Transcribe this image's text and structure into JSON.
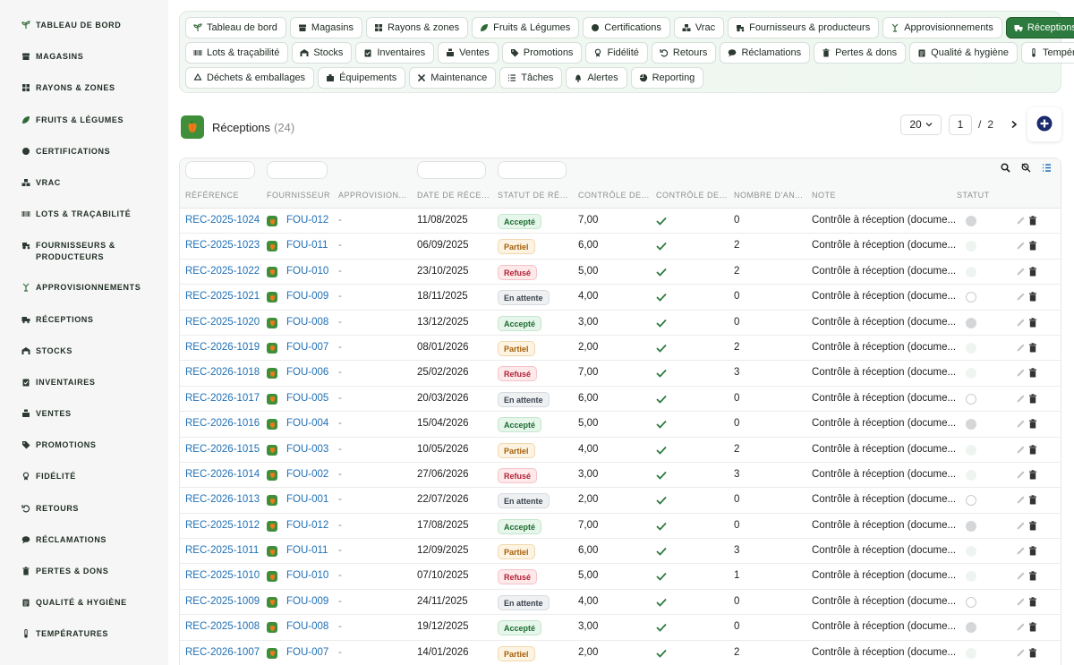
{
  "sidebar": {
    "items": [
      {
        "label": "TABLEAU DE BORD",
        "icon": "sprout-icon"
      },
      {
        "label": "MAGASINS",
        "icon": "store-icon"
      },
      {
        "label": "RAYONS & ZONES",
        "icon": "grid-icon"
      },
      {
        "label": "FRUITS & LÉGUMES",
        "icon": "leaf-icon"
      },
      {
        "label": "CERTIFICATIONS",
        "icon": "badge-icon"
      },
      {
        "label": "VRAC",
        "icon": "boxes-icon"
      },
      {
        "label": "LOTS & TRAÇABILITÉ",
        "icon": "barcode-icon"
      },
      {
        "label": "FOURNISSEURS &",
        "label2": "PRODUCTEURS",
        "icon": "tractor-icon"
      },
      {
        "label": "APPROVISIONNEMENTS",
        "icon": "seedling-icon"
      },
      {
        "label": "RÉCEPTIONS",
        "icon": "truck-icon"
      },
      {
        "label": "STOCKS",
        "icon": "warehouse-icon"
      },
      {
        "label": "INVENTAIRES",
        "icon": "clipboard-icon"
      },
      {
        "label": "VENTES",
        "icon": "cash-register-icon"
      },
      {
        "label": "PROMOTIONS",
        "icon": "tag-icon"
      },
      {
        "label": "FIDÉLITÉ",
        "icon": "award-icon"
      },
      {
        "label": "RETOURS",
        "icon": "undo-icon"
      },
      {
        "label": "RÉCLAMATIONS",
        "icon": "comment-icon"
      },
      {
        "label": "PERTES & DONS",
        "icon": "trash-icon"
      },
      {
        "label": "QUALITÉ & HYGIÈNE",
        "icon": "clipboard-check-icon"
      },
      {
        "label": "TEMPÉRATURES",
        "icon": "thermometer-icon"
      }
    ]
  },
  "tabs": [
    [
      {
        "label": "Tableau de bord",
        "icon": "sprout-icon"
      },
      {
        "label": "Magasins",
        "icon": "store-icon"
      },
      {
        "label": "Rayons & zones",
        "icon": "grid-icon"
      },
      {
        "label": "Fruits & Légumes",
        "icon": "leaf-icon"
      },
      {
        "label": "Certifications",
        "icon": "badge-icon"
      },
      {
        "label": "Vrac",
        "icon": "boxes-icon"
      },
      {
        "label": "Fournisseurs & producteurs",
        "icon": "tractor-icon"
      },
      {
        "label": "Approvisionnements",
        "icon": "seedling-icon"
      },
      {
        "label": "Réceptions",
        "icon": "truck-icon",
        "active": true
      }
    ],
    [
      {
        "label": "Lots & traçabilité",
        "icon": "barcode-icon"
      },
      {
        "label": "Stocks",
        "icon": "warehouse-icon"
      },
      {
        "label": "Inventaires",
        "icon": "clipboard-icon"
      },
      {
        "label": "Ventes",
        "icon": "cash-register-icon"
      },
      {
        "label": "Promotions",
        "icon": "tag-icon"
      },
      {
        "label": "Fidélité",
        "icon": "award-icon"
      },
      {
        "label": "Retours",
        "icon": "undo-icon"
      },
      {
        "label": "Réclamations",
        "icon": "comment-icon"
      },
      {
        "label": "Pertes & dons",
        "icon": "trash-icon"
      },
      {
        "label": "Qualité & hygiène",
        "icon": "clipboard-check-icon"
      },
      {
        "label": "Températures",
        "icon": "thermometer-icon"
      }
    ],
    [
      {
        "label": "Déchets & emballages",
        "icon": "recycle-icon"
      },
      {
        "label": "Équipements",
        "icon": "equipment-icon"
      },
      {
        "label": "Maintenance",
        "icon": "tools-icon"
      },
      {
        "label": "Tâches",
        "icon": "list-icon"
      },
      {
        "label": "Alertes",
        "icon": "bell-icon"
      },
      {
        "label": "Reporting",
        "icon": "chart-pie-icon"
      }
    ]
  ],
  "page": {
    "title": "Réceptions",
    "count": "(24)"
  },
  "pager": {
    "page_size": "20",
    "current_page": "1",
    "separator": "/",
    "total_pages": "2"
  },
  "table": {
    "columns": [
      "RÉFÉRENCE",
      "FOURNISSEUR",
      "APPROVISION...",
      "DATE DE RÉCEP...",
      "STATUT DE RÉC...",
      "CONTRÔLE DE ...",
      "CONTRÔLE DE ...",
      "NOMBRE D'AN...",
      "NOTE",
      "STATUT"
    ],
    "rows": [
      {
        "ref": "REC-2025-1024",
        "supplier": "FOU-012",
        "appro": "-",
        "date": "11/08/2025",
        "status": "Accepté",
        "kind": "accepte",
        "ctrl": "7,00",
        "count": "0",
        "note": "Contrôle à réception (docume...",
        "dot": "grey"
      },
      {
        "ref": "REC-2025-1023",
        "supplier": "FOU-011",
        "appro": "-",
        "date": "06/09/2025",
        "status": "Partiel",
        "kind": "partiel",
        "ctrl": "6,00",
        "count": "2",
        "note": "Contrôle à réception (docume...",
        "dot": "pale"
      },
      {
        "ref": "REC-2025-1022",
        "supplier": "FOU-010",
        "appro": "-",
        "date": "23/10/2025",
        "status": "Refusé",
        "kind": "refuse",
        "ctrl": "5,00",
        "count": "2",
        "note": "Contrôle à réception (docume...",
        "dot": "pale"
      },
      {
        "ref": "REC-2025-1021",
        "supplier": "FOU-009",
        "appro": "-",
        "date": "18/11/2025",
        "status": "En attente",
        "kind": "attente",
        "ctrl": "4,00",
        "count": "0",
        "note": "Contrôle à réception (docume...",
        "dot": "ring"
      },
      {
        "ref": "REC-2025-1020",
        "supplier": "FOU-008",
        "appro": "-",
        "date": "13/12/2025",
        "status": "Accepté",
        "kind": "accepte",
        "ctrl": "3,00",
        "count": "0",
        "note": "Contrôle à réception (docume...",
        "dot": "grey"
      },
      {
        "ref": "REC-2026-1019",
        "supplier": "FOU-007",
        "appro": "-",
        "date": "08/01/2026",
        "status": "Partiel",
        "kind": "partiel",
        "ctrl": "2,00",
        "count": "2",
        "note": "Contrôle à réception (docume...",
        "dot": "pale"
      },
      {
        "ref": "REC-2026-1018",
        "supplier": "FOU-006",
        "appro": "-",
        "date": "25/02/2026",
        "status": "Refusé",
        "kind": "refuse",
        "ctrl": "7,00",
        "count": "3",
        "note": "Contrôle à réception (docume...",
        "dot": "pale"
      },
      {
        "ref": "REC-2026-1017",
        "supplier": "FOU-005",
        "appro": "-",
        "date": "20/03/2026",
        "status": "En attente",
        "kind": "attente",
        "ctrl": "6,00",
        "count": "0",
        "note": "Contrôle à réception (docume...",
        "dot": "ring"
      },
      {
        "ref": "REC-2026-1016",
        "supplier": "FOU-004",
        "appro": "-",
        "date": "15/04/2026",
        "status": "Accepté",
        "kind": "accepte",
        "ctrl": "5,00",
        "count": "0",
        "note": "Contrôle à réception (docume...",
        "dot": "grey"
      },
      {
        "ref": "REC-2026-1015",
        "supplier": "FOU-003",
        "appro": "-",
        "date": "10/05/2026",
        "status": "Partiel",
        "kind": "partiel",
        "ctrl": "4,00",
        "count": "2",
        "note": "Contrôle à réception (docume...",
        "dot": "pale"
      },
      {
        "ref": "REC-2026-1014",
        "supplier": "FOU-002",
        "appro": "-",
        "date": "27/06/2026",
        "status": "Refusé",
        "kind": "refuse",
        "ctrl": "3,00",
        "count": "3",
        "note": "Contrôle à réception (docume...",
        "dot": "pale"
      },
      {
        "ref": "REC-2026-1013",
        "supplier": "FOU-001",
        "appro": "-",
        "date": "22/07/2026",
        "status": "En attente",
        "kind": "attente",
        "ctrl": "2,00",
        "count": "0",
        "note": "Contrôle à réception (docume...",
        "dot": "ring"
      },
      {
        "ref": "REC-2025-1012",
        "supplier": "FOU-012",
        "appro": "-",
        "date": "17/08/2025",
        "status": "Accepté",
        "kind": "accepte",
        "ctrl": "7,00",
        "count": "0",
        "note": "Contrôle à réception (docume...",
        "dot": "grey"
      },
      {
        "ref": "REC-2025-1011",
        "supplier": "FOU-011",
        "appro": "-",
        "date": "12/09/2025",
        "status": "Partiel",
        "kind": "partiel",
        "ctrl": "6,00",
        "count": "3",
        "note": "Contrôle à réception (docume...",
        "dot": "pale"
      },
      {
        "ref": "REC-2025-1010",
        "supplier": "FOU-010",
        "appro": "-",
        "date": "07/10/2025",
        "status": "Refusé",
        "kind": "refuse",
        "ctrl": "5,00",
        "count": "1",
        "note": "Contrôle à réception (docume...",
        "dot": "pale"
      },
      {
        "ref": "REC-2025-1009",
        "supplier": "FOU-009",
        "appro": "-",
        "date": "24/11/2025",
        "status": "En attente",
        "kind": "attente",
        "ctrl": "4,00",
        "count": "0",
        "note": "Contrôle à réception (docume...",
        "dot": "ring"
      },
      {
        "ref": "REC-2025-1008",
        "supplier": "FOU-008",
        "appro": "-",
        "date": "19/12/2025",
        "status": "Accepté",
        "kind": "accepte",
        "ctrl": "3,00",
        "count": "0",
        "note": "Contrôle à réception (docume...",
        "dot": "grey"
      },
      {
        "ref": "REC-2026-1007",
        "supplier": "FOU-007",
        "appro": "-",
        "date": "14/01/2026",
        "status": "Partiel",
        "kind": "partiel",
        "ctrl": "2,00",
        "count": "2",
        "note": "Contrôle à réception (docume...",
        "dot": "pale"
      }
    ]
  },
  "colors": {
    "accent": "#2d7a3e",
    "link": "#1f6fb5",
    "add_button": "#1a2a6c"
  }
}
